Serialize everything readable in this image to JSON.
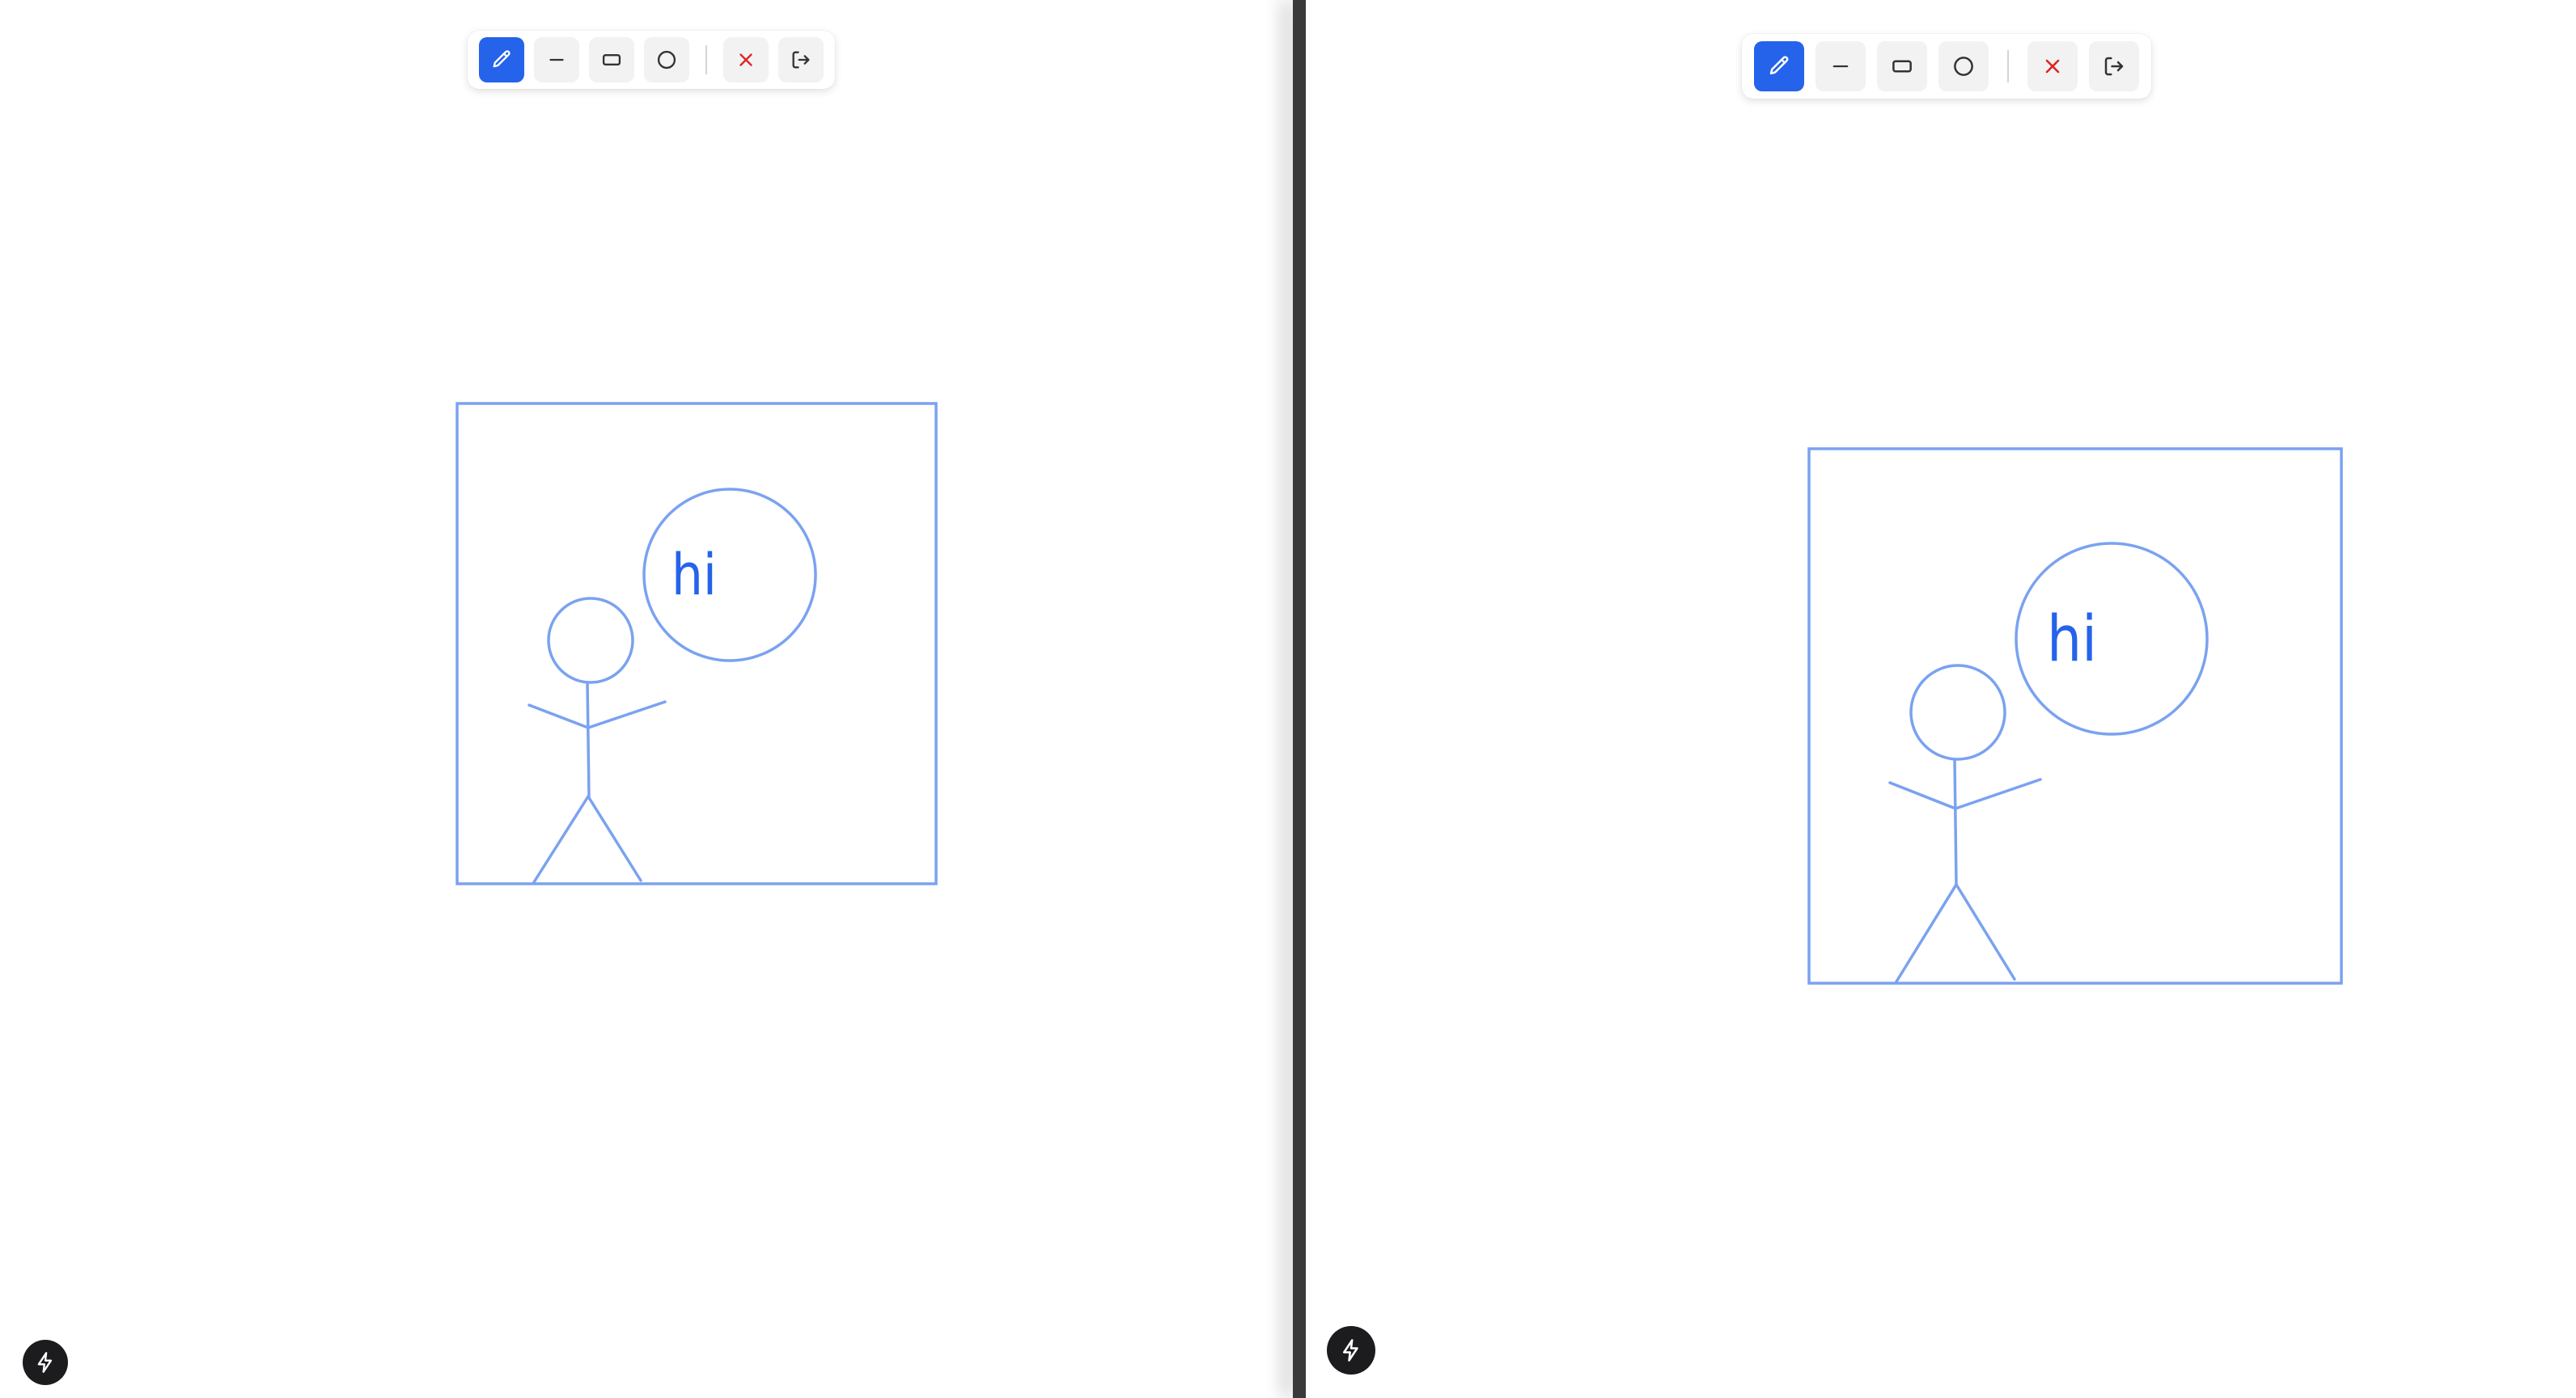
{
  "colors": {
    "accent": "#2563eb",
    "stroke": "#7aa2f0",
    "clear": "#dc2626",
    "toolbar_bg": "#ffffff",
    "button_bg": "#f2f2f3",
    "divider": "#3a3a3a",
    "bolt_bg": "#1c1c1e"
  },
  "toolbar": {
    "tools": [
      {
        "name": "pencil",
        "icon": "pencil-icon",
        "active": true
      },
      {
        "name": "line",
        "icon": "line-icon",
        "active": false
      },
      {
        "name": "rectangle",
        "icon": "rectangle-icon",
        "active": false
      },
      {
        "name": "circle",
        "icon": "circle-icon",
        "active": false
      }
    ],
    "actions": [
      {
        "name": "clear",
        "icon": "close-icon"
      },
      {
        "name": "exit",
        "icon": "logout-icon"
      }
    ]
  },
  "drawing": {
    "speech_text": "hi"
  },
  "dev_indicator": {
    "icon": "lightning-bolt-icon"
  }
}
